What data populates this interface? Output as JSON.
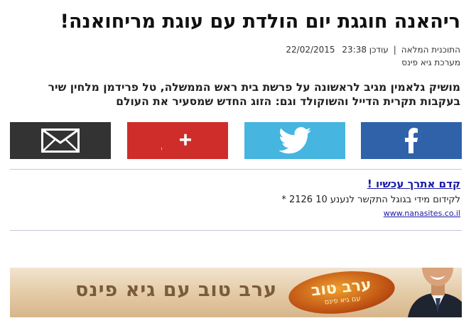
{
  "article": {
    "title": "ריהאנה חוגגת יום הולדת עם עוגת מריחואנה!",
    "section": "התוכנית המלאה",
    "updated_label": "עודכן",
    "time": "23:38",
    "date": "22/02/2015",
    "author": "מערכת גיא פינס",
    "lead": "מושיק גלאמין מגיב לראשונה על פרשת בית ראש הממשלה, טל פרידמן מלחין שיר בעקבות תקרית הדייל והשוקולד וגם: הזוג החדש שמסעיר את העולם"
  },
  "share": {
    "facebook_icon": "facebook-icon",
    "twitter_icon": "twitter-icon",
    "gplus_icon": "google-plus-icon",
    "email_icon": "envelope-icon",
    "colors": {
      "facebook": "#2f62a9",
      "twitter": "#46b5e0",
      "gplus": "#cf2d2a",
      "email": "#333333"
    }
  },
  "ad": {
    "title": "קדם אתרך עכשיו !",
    "text": "לקידום מידי בגוגל התקשר לנענע 10 2126 *",
    "url": "www.nanasites.co.il"
  },
  "banner": {
    "text": "ערב טוב עם גיא פינס",
    "logo_main": "ערב טוב",
    "logo_sub": "עם גיא פינס"
  }
}
